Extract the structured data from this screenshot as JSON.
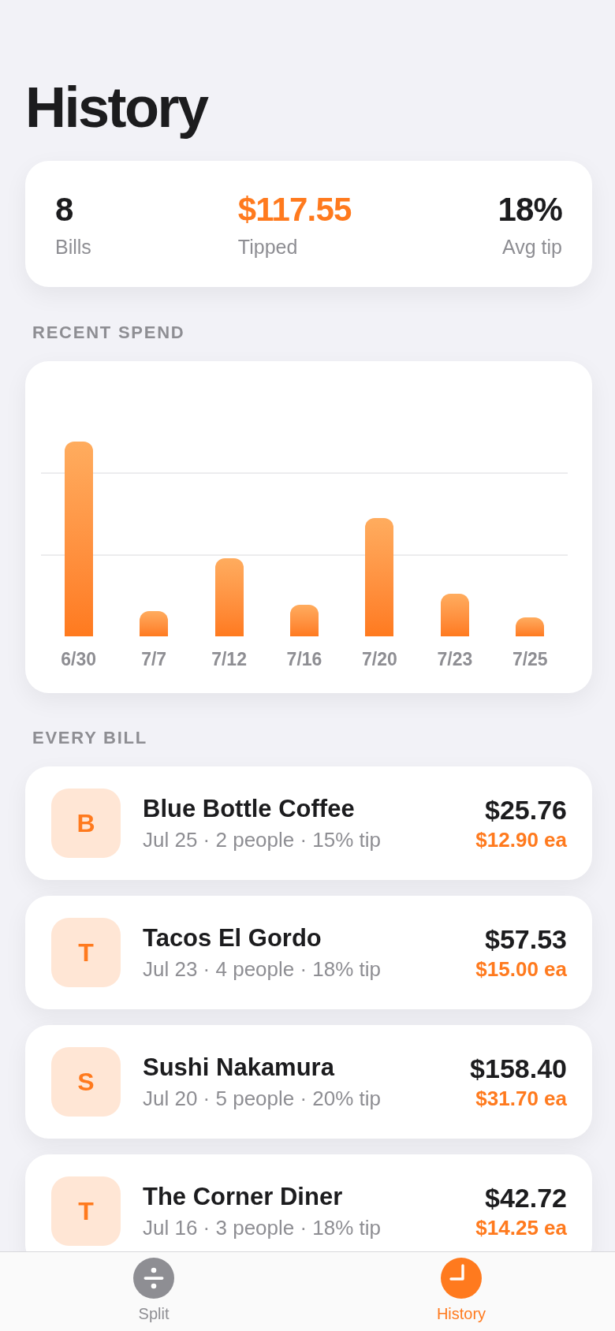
{
  "screen": {
    "title": "History"
  },
  "summary": [
    {
      "value": "8",
      "label": "Bills",
      "kind": "plain"
    },
    {
      "value": "$117.55",
      "label": "Tipped",
      "kind": "accent"
    },
    {
      "value": "18%",
      "label": "Avg tip",
      "kind": "plain"
    }
  ],
  "recent_spend": {
    "heading": "RECENT SPEND",
    "date_labels": [
      "6/30",
      "7/7",
      "7/12",
      "7/16",
      "7/20",
      "7/23",
      "7/25"
    ]
  },
  "every_bill": {
    "heading": "EVERY BILL",
    "bills": [
      {
        "initial": "B",
        "name": "Blue Bottle Coffee",
        "details": "Jul 25 · 2 people · 15% tip",
        "total": "$25.76",
        "each": "$12.90 ea"
      },
      {
        "initial": "T",
        "name": "Tacos El Gordo",
        "details": "Jul 23 · 4 people · 18% tip",
        "total": "$57.53",
        "each": "$15.00 ea"
      },
      {
        "initial": "S",
        "name": "Sushi Nakamura",
        "details": "Jul 20 · 5 people · 20% tip",
        "total": "$158.40",
        "each": "$31.70 ea"
      },
      {
        "initial": "T",
        "name": "The Corner Diner",
        "details": "Jul 16 · 3 people · 18% tip",
        "total": "$42.72",
        "each": "$14.25 ea"
      }
    ]
  },
  "tab_bar": [
    {
      "label": "Split",
      "selected": false
    },
    {
      "label": "History",
      "selected": true
    }
  ]
}
